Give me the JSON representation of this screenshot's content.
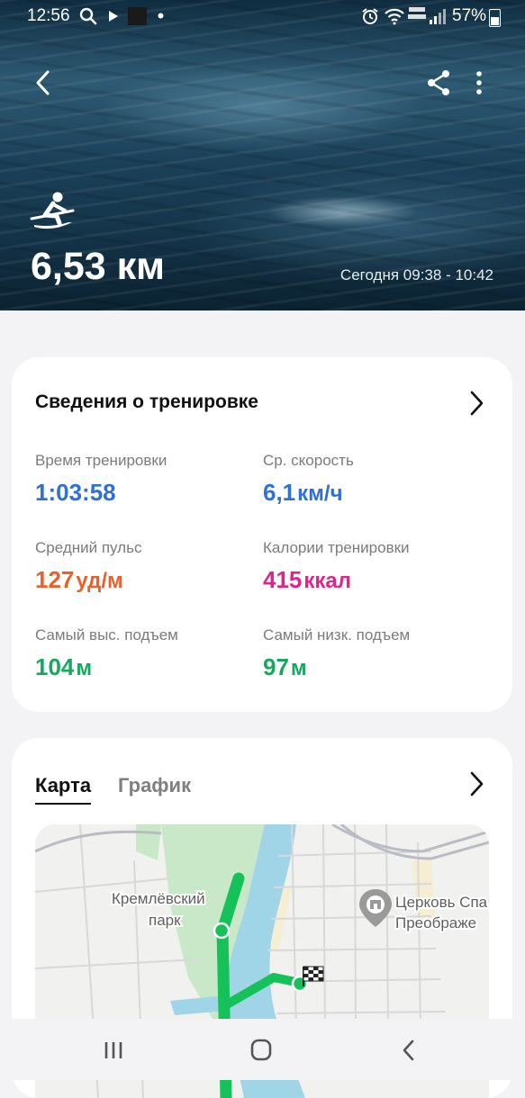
{
  "status_bar": {
    "time": "12:56",
    "battery": "57%",
    "battery_level": 0.57,
    "icons": [
      "search-icon",
      "play-icon",
      "square-app-icon",
      "dot-icon",
      "alarm-icon",
      "wifi-icon",
      "volte-icon",
      "signal-icon",
      "battery-icon"
    ]
  },
  "header": {
    "back_icon": "back-arrow-icon",
    "share_icon": "share-icon",
    "more_icon": "more-vertical-icon",
    "sport_icon": "rowing-icon",
    "distance": "6,53 км",
    "time_range": "Сегодня 09:38 - 10:42"
  },
  "workout": {
    "title": "Сведения о тренировке",
    "stats": [
      {
        "label": "Время тренировки",
        "value": "1:03:58",
        "unit": "",
        "color": "#2f6fd6"
      },
      {
        "label": "Ср. скорость",
        "value": "6,1",
        "unit": "км/ч",
        "color": "#2f6fd6"
      },
      {
        "label": "Средний пульс",
        "value": "127",
        "unit": "уд/м",
        "color": "#e8602c"
      },
      {
        "label": "Калории тренировки",
        "value": "415",
        "unit": "ккал",
        "color": "#e0238a"
      },
      {
        "label": "Самый выс. подъем",
        "value": "104",
        "unit": "м",
        "color": "#16a95e"
      },
      {
        "label": "Самый низк. подъем",
        "value": "97",
        "unit": "м",
        "color": "#16a95e"
      }
    ]
  },
  "map_card": {
    "tabs": [
      {
        "label": "Карта",
        "active": true
      },
      {
        "label": "График",
        "active": false
      }
    ],
    "park_label": [
      "Кремлёвский",
      "парк"
    ],
    "church_label": [
      "Церковь Спа",
      "Преображе"
    ],
    "route_color": "#15c25a",
    "river_color": "#9fd5e6",
    "park_color": "#c9e8c8"
  },
  "nav_bar": {
    "recents_icon": "recents-icon",
    "home_icon": "home-icon",
    "back_icon": "nav-back-icon"
  }
}
